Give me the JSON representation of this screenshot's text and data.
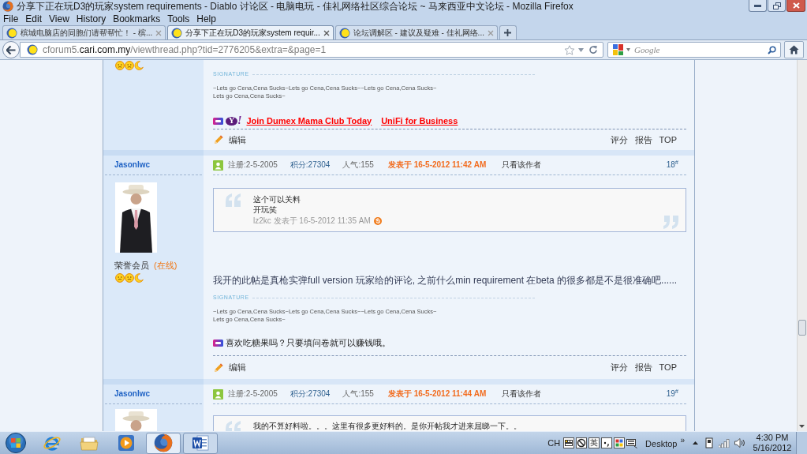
{
  "window": {
    "title": "分享下正在玩D3的玩家system requirements - Diablo 讨论区 - 电脑电玩 - 佳礼网络社区综合论坛 ~ 马来西亚中文论坛 - Mozilla Firefox"
  },
  "menu": [
    "File",
    "Edit",
    "View",
    "History",
    "Bookmarks",
    "Tools",
    "Help"
  ],
  "tabs": [
    {
      "label": "槟城电脑店的同胞们请帮帮忙！ - 槟...",
      "selected": false
    },
    {
      "label": "分享下正在玩D3的玩家system requir...",
      "selected": true
    },
    {
      "label": "论坛调解区 - 建议及疑难 - 佳礼网络...",
      "selected": false
    }
  ],
  "address": {
    "url": [
      {
        "text": "cforum5.",
        "kind": "dim"
      },
      {
        "text": "cari.com.my",
        "kind": "domain"
      },
      {
        "text": "/viewthread.php?tid=2776205&extra=&page=1",
        "kind": "dim"
      }
    ]
  },
  "search": {
    "placeholder": "Google"
  },
  "posts": [
    {
      "kind": "continued",
      "signature": {
        "label": "SIGNATURE",
        "lines": [
          "~Lets go Cena,Cena Sucks~Lets go Cena,Cena Sucks~~Lets go Cena,Cena Sucks~",
          "Lets go Cena,Cena Sucks~"
        ]
      },
      "ad": {
        "logo": {
          "letter": "Y",
          "mark": "!"
        },
        "links": [
          "Join Dumex Mama Club Today",
          "UniFi for Business"
        ]
      },
      "actions": {
        "edit": "编辑",
        "links": [
          "评分",
          "报告",
          "TOP"
        ]
      }
    },
    {
      "kind": "full",
      "author": "Jasonlwc",
      "rank": "荣誉会员",
      "online": "(在线)",
      "meta": {
        "registered": "注册:2-5-2005",
        "points": "积分:27304",
        "popularity": "人气:155",
        "posted": "发表于 16-5-2012 11:42 AM",
        "author_only": "只看该作者",
        "floor": "18$^{#}$"
      },
      "quote": {
        "lines": [
          "这个可以关料",
          "开玩笑"
        ],
        "byline": "lz2kc 发表于 16-5-2012 11:35 AM"
      },
      "message": "我开的此帖是真枪实弹full version 玩家给的评论, 之前什么min requirement 在beta 的很多都是不是很准确吧......",
      "signature": {
        "label": "SIGNATURE",
        "lines": [
          "~Lets go Cena,Cena Sucks~Lets go Cena,Cena Sucks~~Lets go Cena,Cena Sucks~",
          "Lets go Cena,Cena Sucks~"
        ]
      },
      "ad": {
        "text": "喜欢吃糖果吗？只要填问卷就可以赚钱哦。"
      },
      "actions": {
        "edit": "编辑",
        "links": [
          "评分",
          "报告",
          "TOP"
        ]
      }
    },
    {
      "kind": "cut",
      "author": "Jasonlwc",
      "meta": {
        "registered": "注册:2-5-2005",
        "points": "积分:27304",
        "popularity": "人气:155",
        "posted": "发表于 16-5-2012 11:44 AM",
        "author_only": "只看该作者",
        "floor": "19$^{#}$"
      },
      "quote": {
        "lines": [
          "我的不算好料啦。。。这里有很多更好料的。是你开帖我才进来屈睇一下。。"
        ]
      }
    }
  ],
  "taskbar": {
    "apps": [
      {
        "kind": "ie",
        "running": false,
        "selected": false
      },
      {
        "kind": "explorer",
        "running": false,
        "selected": false
      },
      {
        "kind": "media",
        "running": false,
        "selected": false
      },
      {
        "kind": "firefox",
        "running": true,
        "selected": true
      },
      {
        "kind": "word",
        "running": true,
        "selected": false
      }
    ],
    "language": "CH",
    "ime": "英",
    "toolbar": "Desktop",
    "more": "»",
    "time": "4:30 PM",
    "date": "5/16/2012"
  }
}
